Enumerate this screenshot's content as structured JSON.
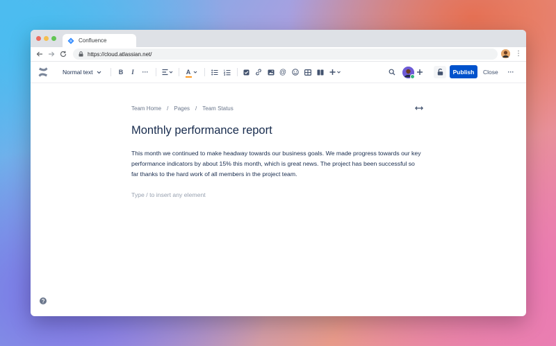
{
  "browser": {
    "tab_title": "Confluence",
    "url": "https://cloud.atlassian.net/"
  },
  "toolbar": {
    "text_style": "Normal text",
    "bold_label": "B",
    "italic_label": "I",
    "more_label": "···",
    "text_color_label": "A",
    "mention_label": "@",
    "publish_label": "Publish",
    "close_label": "Close",
    "more_actions_label": "···"
  },
  "breadcrumb": {
    "items": [
      "Team Home",
      "Pages",
      "Team Status"
    ],
    "separator": "/"
  },
  "page": {
    "title": "Monthly performance report",
    "body": "This month we continued to make headway towards our business goals. We made progress towards our key performance indicators by about 15% this month, which is great news. The project has been successful so far thanks to the hard work of all members in the project team.",
    "placeholder": "Type / to insert any element"
  },
  "colors": {
    "accent": "#0052cc",
    "text": "#172b4d",
    "muted": "#6b778c",
    "online": "#36b37e"
  }
}
